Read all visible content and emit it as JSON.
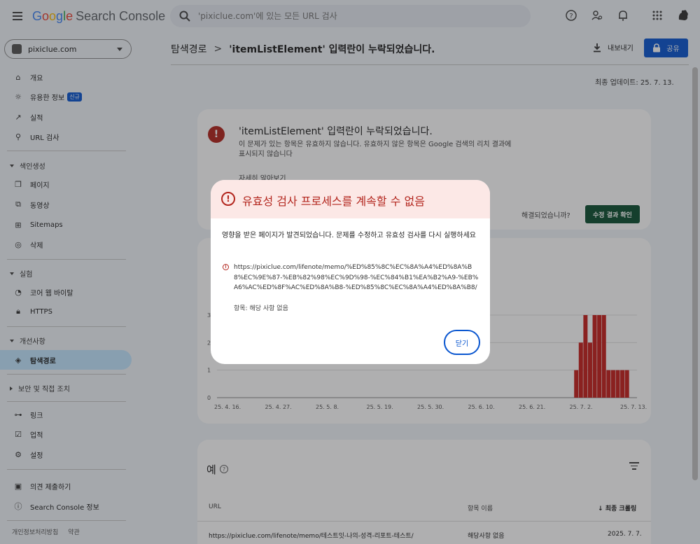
{
  "app": {
    "logo_google": [
      "G",
      "o",
      "o",
      "g",
      "l",
      "e"
    ],
    "logo_product": "Search Console"
  },
  "search": {
    "placeholder": "'pixiclue.com'에 있는 모든 URL 검사"
  },
  "property": {
    "name": "pixiclue.com"
  },
  "sidebar": {
    "items": [
      {
        "label": "개요",
        "icon": "home-icon"
      },
      {
        "label": "유용한 정보",
        "badge": "신규",
        "icon": "lightbulb-icon"
      },
      {
        "label": "실적",
        "icon": "trending-icon"
      },
      {
        "label": "URL 검사",
        "icon": "search-icon"
      }
    ],
    "sections": {
      "indexing": "색인생성",
      "experience": "실험",
      "enhancements": "개선사항",
      "security": "보안 및 직접 조치"
    },
    "indexing_items": [
      {
        "label": "페이지",
        "icon": "pages-icon"
      },
      {
        "label": "동영상",
        "icon": "video-icon"
      },
      {
        "label": "Sitemaps",
        "icon": "sitemap-icon"
      },
      {
        "label": "삭제",
        "icon": "eye-off-icon"
      }
    ],
    "experience_items": [
      {
        "label": "코어 웹 바이탈",
        "icon": "speed-icon"
      },
      {
        "label": "HTTPS",
        "icon": "lock-icon"
      }
    ],
    "enhancement_items": [
      {
        "label": "탐색경로",
        "icon": "layers-icon"
      }
    ],
    "bottom_items": [
      {
        "label": "링크",
        "icon": "links-icon"
      },
      {
        "label": "업적",
        "icon": "achievement-icon"
      },
      {
        "label": "설정",
        "icon": "settings-icon"
      }
    ],
    "extra_items": [
      {
        "label": "의견 제출하기",
        "icon": "feedback-icon"
      },
      {
        "label": "Search Console 정보",
        "icon": "info-icon"
      }
    ],
    "footer": [
      "개인정보처리방침",
      "약관"
    ]
  },
  "header": {
    "breadcrumb_parent": "탐색경로",
    "breadcrumb_sep": ">",
    "breadcrumb_current": "'itemListElement' 입력란이 누락되었습니다.",
    "export_label": "내보내기",
    "share_label": "공유",
    "updated": "최종 업데이트: 25. 7. 13."
  },
  "issue_card": {
    "title": "'itemListElement' 입력란이 누락되었습니다.",
    "description": "이 문제가 있는 항목은 유효하지 않습니다. 유효하지 않은 항목은 Google 검색의 리치 결과에 표시되지 않습니다",
    "learn_more": "자세히 알아보기",
    "resolved_question": "해결되었습니까?",
    "verify_button": "수정 결과 확인"
  },
  "chart_data": {
    "type": "bar",
    "x_tick_labels": [
      "25. 4. 16.",
      "25. 4. 27.",
      "25. 5. 8.",
      "25. 5. 19.",
      "25. 5. 30.",
      "25. 6. 10.",
      "25. 6. 21.",
      "25. 7. 2.",
      "25. 7. 13."
    ],
    "y_tick_labels": [
      "0",
      "1",
      "2",
      "3"
    ],
    "ylim": [
      0,
      3
    ],
    "series": [
      {
        "color": "#c5221f",
        "x": [
          "25. 7. 2.",
          "25. 7. 3.",
          "25. 7. 4.",
          "25. 7. 5.",
          "25. 7. 6.",
          "25. 7. 7.",
          "25. 7. 8.",
          "25. 7. 9.",
          "25. 7. 10.",
          "25. 7. 11.",
          "25. 7. 12.",
          "25. 7. 13."
        ],
        "values": [
          1,
          2,
          3,
          2,
          3,
          3,
          3,
          1,
          1,
          1,
          1,
          1
        ]
      }
    ]
  },
  "examples": {
    "title": "예",
    "columns": {
      "url": "URL",
      "item": "항목 이름",
      "crawl": "최종 크롤링"
    },
    "rows": [
      {
        "url": "https://pixiclue.com/lifenote/memo/테스트잇-나의-성격-리포트-테스트/",
        "item": "해당사항 없음",
        "crawl": "2025. 7. 7."
      }
    ]
  },
  "dialog": {
    "title": "유효성 검사 프로세스를 계속할 수 없음",
    "message": "영향을 받은 페이지가 발견되었습니다. 문제를 수정하고 유효성 검사를 다시 실행하세요",
    "url": "https://pixiclue.com/lifenote/memo/%ED%85%8C%EC%8A%A4%ED%8A%B8%EC%9E%87-%EB%82%98%EC%9D%98-%EC%84%B1%EA%B2%A9-%EB%A6%AC%ED%8F%AC%ED%8A%B8-%ED%85%8C%EC%8A%A4%ED%8A%B8/",
    "item": "항목: 해당 사항 없음",
    "close_label": "닫기"
  }
}
